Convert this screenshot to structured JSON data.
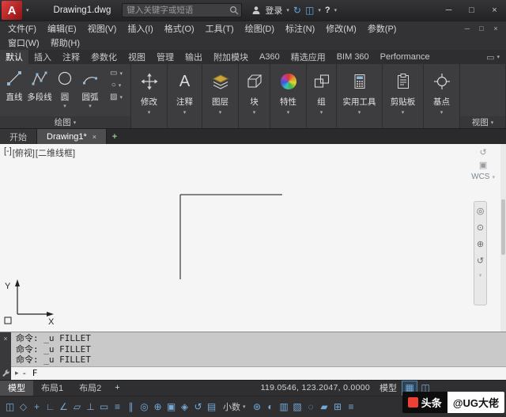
{
  "icons": {
    "chevron_down": "▾",
    "minimize": "─",
    "restore": "□",
    "maximize": "□",
    "close": "×",
    "plus": "+",
    "sync": "↻",
    "apps": "◫",
    "help": "?",
    "grid": "▦",
    "snap": "◫",
    "panel_toggle": "▭",
    "nav_wheel": "◎",
    "nav_pan": "⊙",
    "nav_zoom": "⊕",
    "nav_orbit": "↺",
    "viewcube_home": "↺",
    "viewcube_face": "▣",
    "rect_tool": "▭",
    "ellipse_tool": "○",
    "hatch_tool": "▨",
    "prompt": "▸"
  },
  "titlebar": {
    "logo_letter": "A",
    "doc_title": "Drawing1.dwg",
    "search_placeholder": "键入关键字或短语",
    "login_label": "登录"
  },
  "menubar": {
    "row1": [
      "文件(F)",
      "编辑(E)",
      "视图(V)",
      "插入(I)",
      "格式(O)",
      "工具(T)",
      "绘图(D)",
      "标注(N)",
      "修改(M)",
      "参数(P)"
    ],
    "row2": [
      "窗口(W)",
      "帮助(H)"
    ]
  },
  "ribbon": {
    "tabs": [
      "默认",
      "插入",
      "注释",
      "参数化",
      "视图",
      "管理",
      "输出",
      "附加模块",
      "A360",
      "精选应用",
      "BIM 360",
      "Performance"
    ],
    "draw_panel_label": "绘图",
    "draw_tools": [
      "直线",
      "多段线",
      "圆",
      "圆弧"
    ],
    "panels": [
      "修改",
      "注释",
      "图层",
      "块",
      "特性",
      "组",
      "实用工具",
      "剪贴板",
      "基点"
    ],
    "view_panel_label": "视图"
  },
  "doc_tabs": {
    "start_tab": "开始",
    "active_tab": "Drawing1*"
  },
  "drawing": {
    "vp_controls": [
      "[-]",
      "[俯视]",
      "[二维线框]"
    ],
    "wcs_label": "WCS",
    "axis_x": "X",
    "axis_y": "Y"
  },
  "command": {
    "history": [
      "命令: _u FILLET",
      "命令: _u FILLET",
      "命令: _u FILLET"
    ],
    "input_value": "- F"
  },
  "layout_bar": {
    "tabs": [
      "模型",
      "布局1",
      "布局2"
    ],
    "coordinates": "119.0546, 123.2047, 0.0000",
    "model_toggle": "模型"
  },
  "statusbar": {
    "icons_left": [
      "◫",
      "◇",
      "+",
      "∟",
      "∠",
      "▱",
      "⊥",
      "▭",
      "≡",
      "∥",
      "◎",
      "⊕",
      "▣",
      "◈",
      "↺",
      "▤"
    ],
    "annotation_scale": "小数",
    "icons_right": [
      "⊛",
      "◐",
      "▥",
      "▧",
      "◌",
      "▰",
      "⊞",
      "≡"
    ]
  },
  "watermark": {
    "brand": "头条",
    "handle": "@UG大佬"
  }
}
